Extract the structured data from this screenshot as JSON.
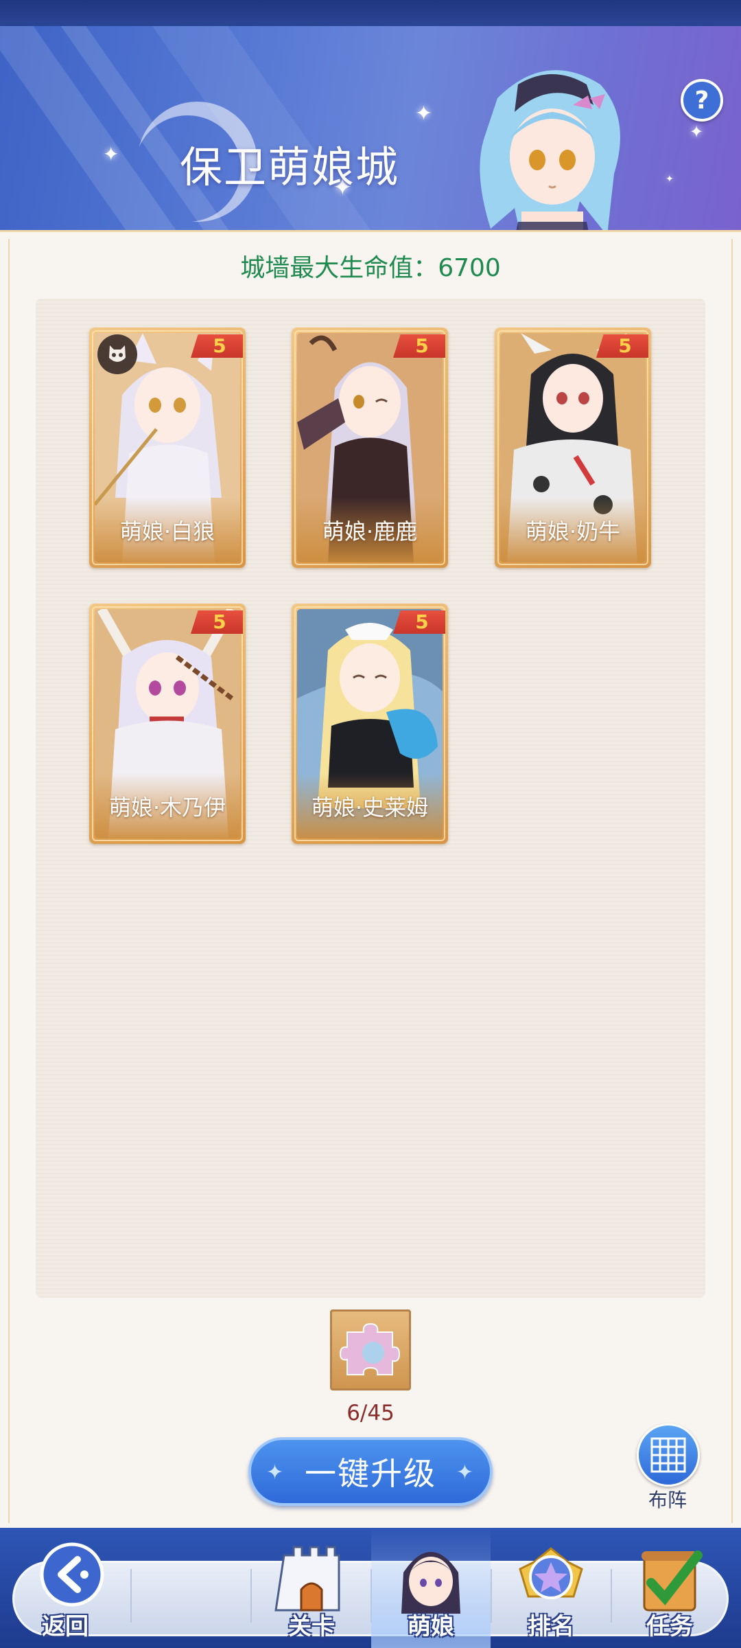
{
  "header": {
    "title": "保卫萌娘城",
    "help_label": "?"
  },
  "wall": {
    "text": "城墙最大生命值：6700"
  },
  "cards": [
    {
      "name": "萌娘·白狼",
      "level": "5",
      "theme": "#e9e4f2",
      "hair": "#dcd8ee"
    },
    {
      "name": "萌娘·鹿鹿",
      "level": "5",
      "theme": "#6f4a4a",
      "hair": "#ddd6e8"
    },
    {
      "name": "萌娘·奶牛",
      "level": "5",
      "theme": "#ecebec",
      "hair": "#2a2a2e"
    },
    {
      "name": "萌娘·木乃伊",
      "level": "5",
      "theme": "#e9dcef",
      "hair": "#e7e3f4"
    },
    {
      "name": "萌娘·史莱姆",
      "level": "5",
      "theme": "#7ab8e6",
      "hair": "#f6e29a"
    }
  ],
  "puzzle": {
    "icon": "puzzle-piece-icon",
    "count": "6/45"
  },
  "upgrade_button": "一键升级",
  "formation": {
    "label": "布阵",
    "icon": "grid-icon"
  },
  "nav": {
    "back": "返回",
    "items": [
      {
        "label": "关卡",
        "icon": "castle-icon"
      },
      {
        "label": "萌娘",
        "icon": "girl-portrait-icon"
      },
      {
        "label": "排名",
        "icon": "star-medal-icon"
      },
      {
        "label": "任务",
        "icon": "checkmark-scroll-icon"
      }
    ]
  },
  "colors": {
    "accent_blue": "#2f6ad9",
    "hp_green": "#1e8a4f",
    "level_red": "#d13c2f",
    "card_gold": "#d89545"
  }
}
